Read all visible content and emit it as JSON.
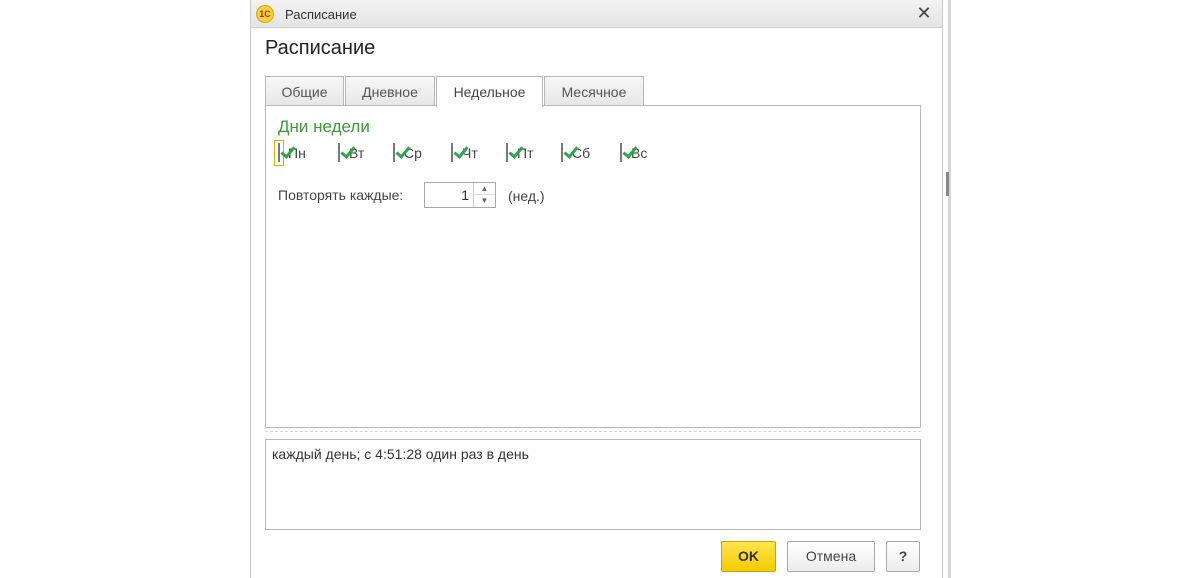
{
  "window": {
    "title": "Расписание",
    "app_icon": "1С",
    "close_glyph": "✕"
  },
  "form": {
    "title": "Расписание"
  },
  "tabs": [
    {
      "label": "Общие",
      "active": false
    },
    {
      "label": "Дневное",
      "active": false
    },
    {
      "label": "Недельное",
      "active": true
    },
    {
      "label": "Месячное",
      "active": false
    }
  ],
  "weekly": {
    "group_title": "Дни недели",
    "days": [
      {
        "label": "Пн",
        "checked": true
      },
      {
        "label": "Вт",
        "checked": true
      },
      {
        "label": "Ср",
        "checked": true
      },
      {
        "label": "Чт",
        "checked": true
      },
      {
        "label": "Пт",
        "checked": true
      },
      {
        "label": "Сб",
        "checked": true
      },
      {
        "label": "Вс",
        "checked": true
      }
    ],
    "repeat_label": "Повторять каждые:",
    "repeat_value": "1",
    "repeat_unit": "(нед.)"
  },
  "description": "каждый день; с 4:51:28 один раз в день",
  "buttons": {
    "ok": "OK",
    "cancel": "Отмена",
    "help": "?"
  },
  "colors": {
    "accent_green": "#3a9a3a",
    "ok_button": "#f4cc00",
    "focus_border": "#e0b000"
  }
}
